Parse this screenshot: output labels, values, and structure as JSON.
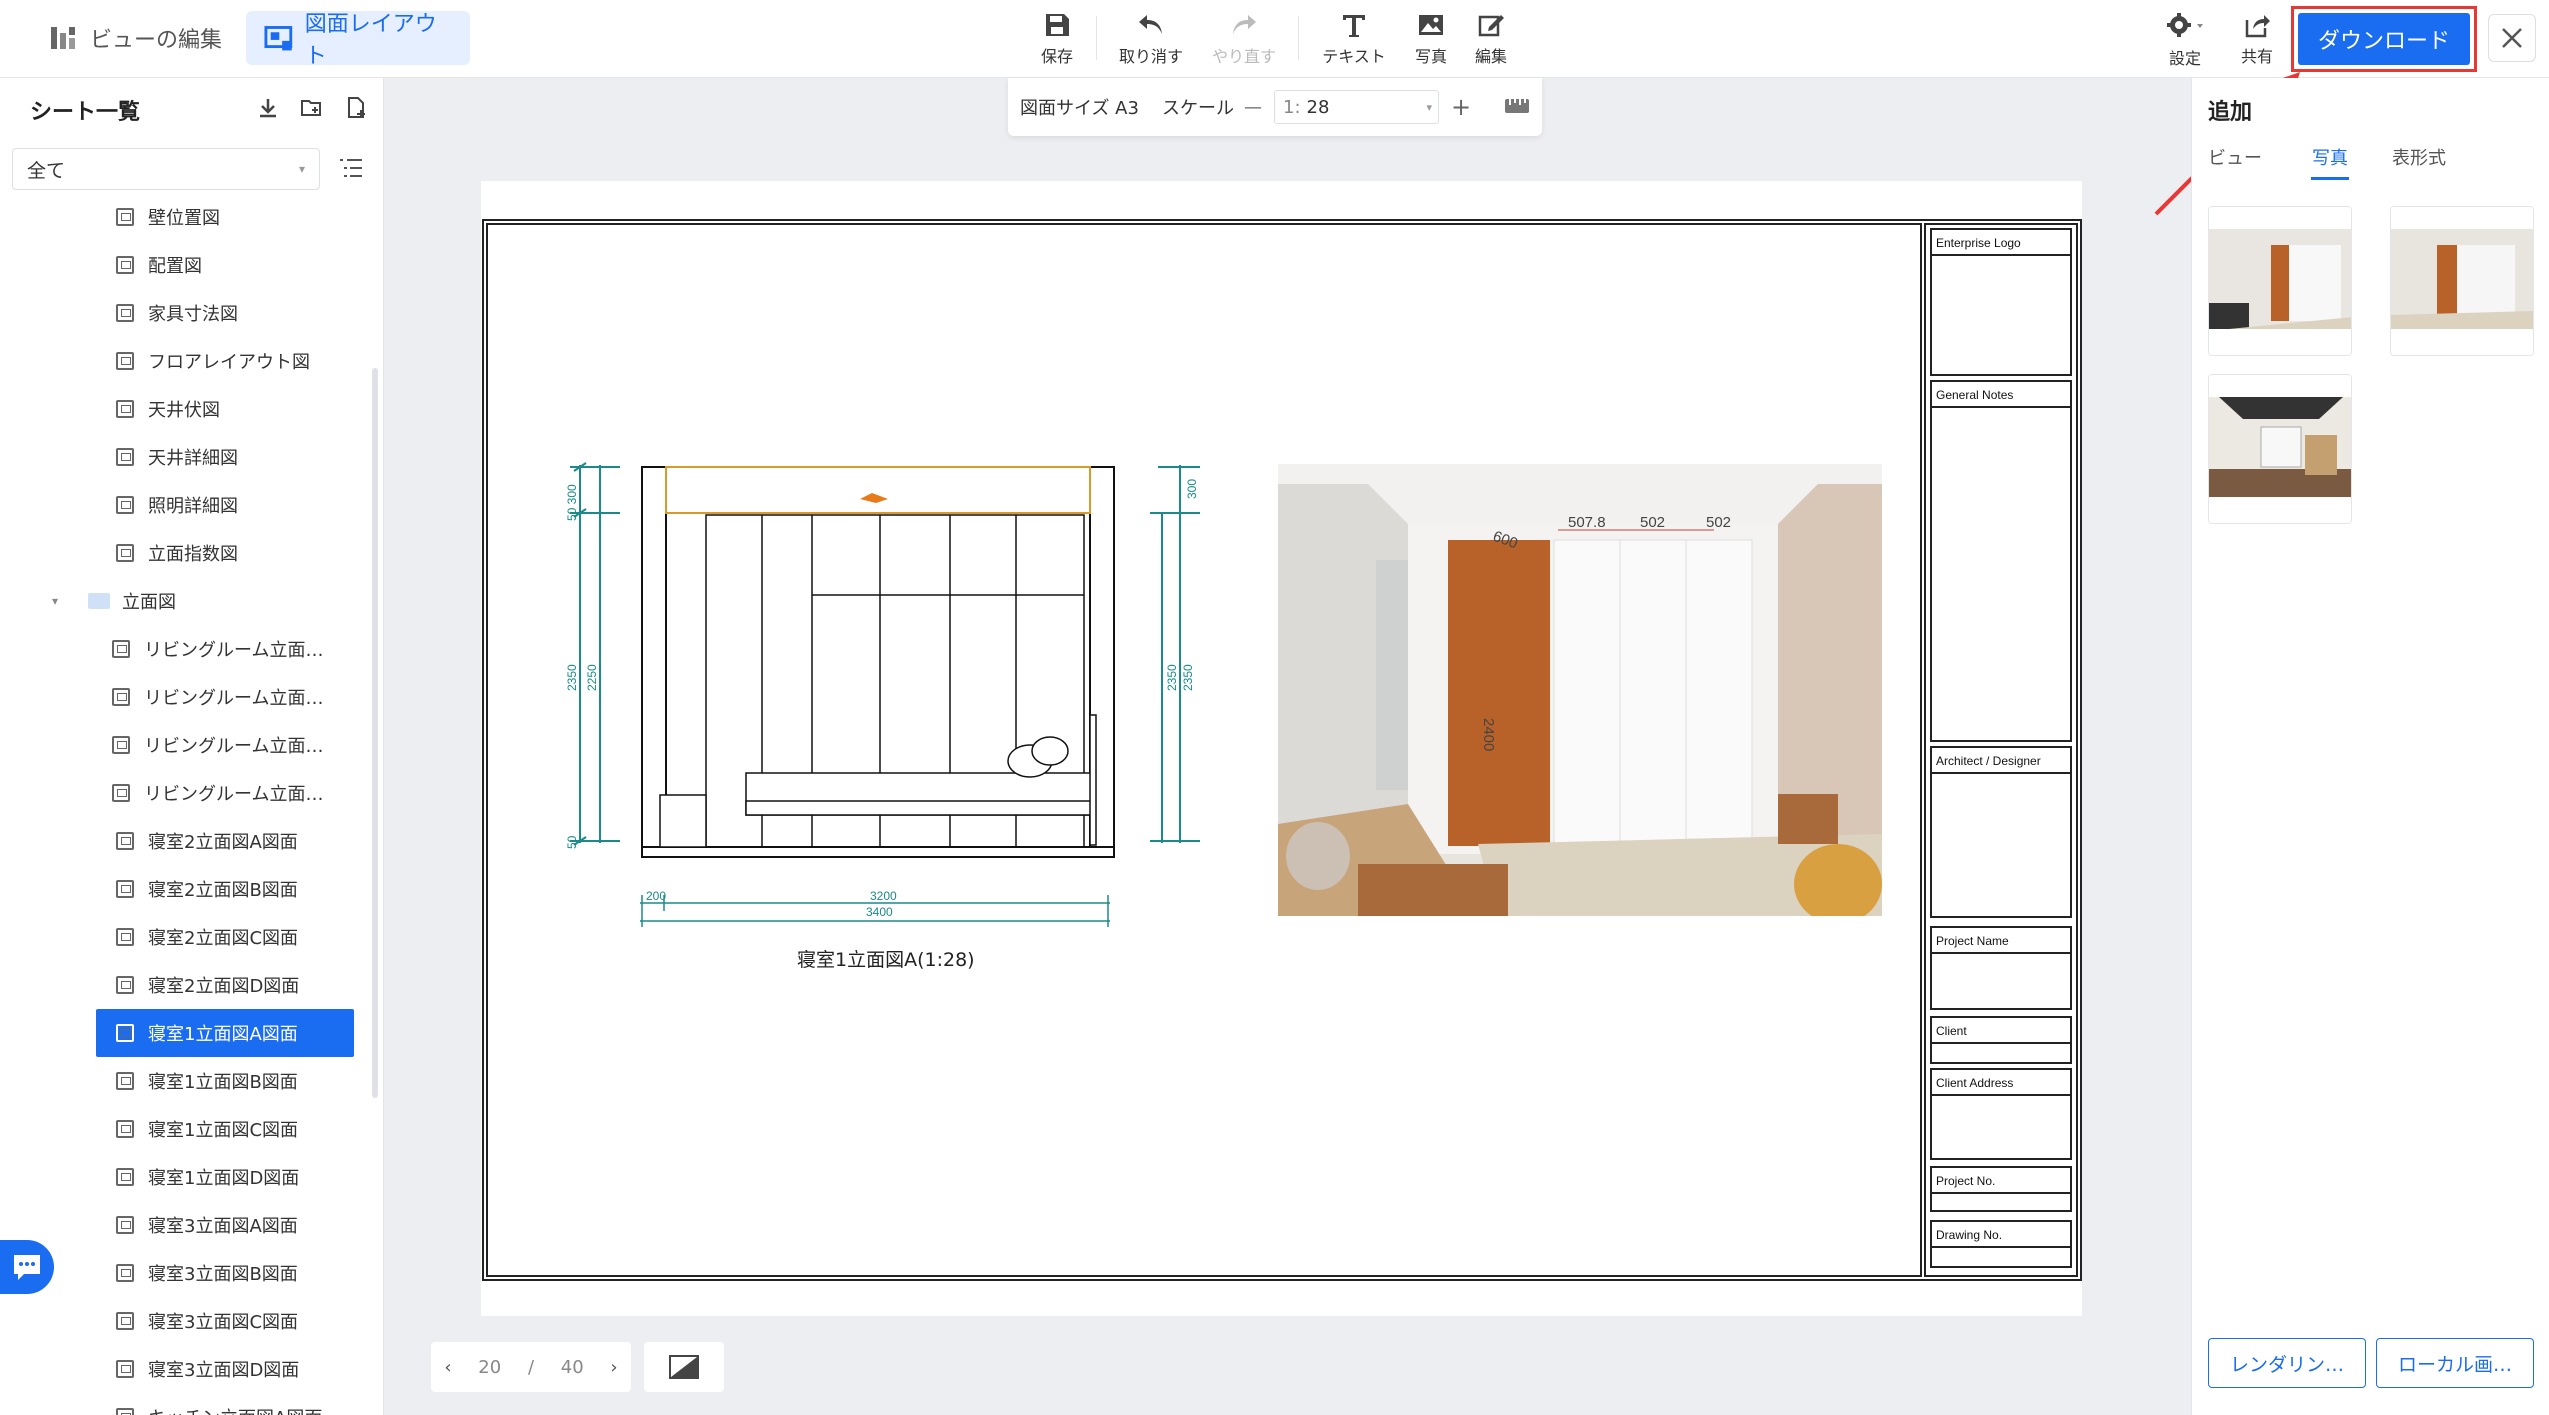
{
  "header": {
    "modes": [
      {
        "label": "ビューの編集",
        "active": false
      },
      {
        "label": "図面レイアウト",
        "active": true
      }
    ],
    "tools": [
      {
        "label": "保存",
        "icon": "save-icon",
        "enabled": true
      },
      {
        "label": "取り消す",
        "icon": "undo-icon",
        "enabled": true
      },
      {
        "label": "やり直す",
        "icon": "redo-icon",
        "enabled": false
      },
      {
        "label": "テキスト",
        "icon": "text-icon",
        "enabled": true
      },
      {
        "label": "写真",
        "icon": "photo-icon",
        "enabled": true
      },
      {
        "label": "編集",
        "icon": "edit-icon",
        "enabled": true
      }
    ],
    "settings_label": "設定",
    "share_label": "共有",
    "download_label": "ダウンロード"
  },
  "sidebar": {
    "title": "シート一覧",
    "filter_value": "全て",
    "items": [
      {
        "label": "壁位置図",
        "indent": 2,
        "type": "file"
      },
      {
        "label": "配置図",
        "indent": 2,
        "type": "file"
      },
      {
        "label": "家具寸法図",
        "indent": 2,
        "type": "file"
      },
      {
        "label": "フロアレイアウト図",
        "indent": 2,
        "type": "file"
      },
      {
        "label": "天井伏図",
        "indent": 2,
        "type": "file"
      },
      {
        "label": "天井詳細図",
        "indent": 2,
        "type": "file"
      },
      {
        "label": "照明詳細図",
        "indent": 2,
        "type": "file"
      },
      {
        "label": "立面指数図",
        "indent": 2,
        "type": "file"
      },
      {
        "label": "立面図",
        "indent": 1,
        "type": "folder"
      },
      {
        "label": "リビングルーム立面…",
        "indent": 2,
        "type": "file"
      },
      {
        "label": "リビングルーム立面…",
        "indent": 2,
        "type": "file"
      },
      {
        "label": "リビングルーム立面…",
        "indent": 2,
        "type": "file"
      },
      {
        "label": "リビングルーム立面…",
        "indent": 2,
        "type": "file"
      },
      {
        "label": "寝室2立面図A図面",
        "indent": 2,
        "type": "file"
      },
      {
        "label": "寝室2立面図B図面",
        "indent": 2,
        "type": "file"
      },
      {
        "label": "寝室2立面図C図面",
        "indent": 2,
        "type": "file"
      },
      {
        "label": "寝室2立面図D図面",
        "indent": 2,
        "type": "file"
      },
      {
        "label": "寝室1立面図A図面",
        "indent": 2,
        "type": "file",
        "selected": true
      },
      {
        "label": "寝室1立面図B図面",
        "indent": 2,
        "type": "file"
      },
      {
        "label": "寝室1立面図C図面",
        "indent": 2,
        "type": "file"
      },
      {
        "label": "寝室1立面図D図面",
        "indent": 2,
        "type": "file"
      },
      {
        "label": "寝室3立面図A図面",
        "indent": 2,
        "type": "file"
      },
      {
        "label": "寝室3立面図B図面",
        "indent": 2,
        "type": "file"
      },
      {
        "label": "寝室3立面図C図面",
        "indent": 2,
        "type": "file"
      },
      {
        "label": "寝室3立面図D図面",
        "indent": 2,
        "type": "file"
      },
      {
        "label": "キッチン立面図A図面",
        "indent": 2,
        "type": "file"
      }
    ]
  },
  "canvas": {
    "paper_size_label": "図面サイズ A3",
    "scale_label": "スケール",
    "scale_prefix": "1:",
    "scale_value": "28",
    "elevation_caption": "寝室1立面図A(1:28)",
    "dims": {
      "left_top": "50 300",
      "left_mid_a": "2350",
      "left_mid_b": "2250",
      "left_bottom": "50",
      "right_top": "300",
      "right_mid_a": "2350",
      "right_mid_b": "2350",
      "bottom_small": "200",
      "bottom_inner": "3200",
      "bottom_total": "3400"
    },
    "render_dims": [
      "600",
      "507.8",
      "502",
      "502",
      "2400"
    ],
    "title_block": [
      "Enterprise Logo",
      "General Notes",
      "Architect / Designer",
      "Project Name",
      "Client",
      "Client Address",
      "Project No.",
      "Drawing No."
    ],
    "pager": {
      "current": "20",
      "separator": "/",
      "total": "40"
    }
  },
  "right_panel": {
    "title": "追加",
    "tabs": [
      {
        "label": "ビュー",
        "active": false
      },
      {
        "label": "写真",
        "active": true
      },
      {
        "label": "表形式",
        "active": false
      }
    ],
    "thumbnails": [
      "render-thumb-1",
      "render-thumb-2",
      "render-thumb-3"
    ],
    "buttons": [
      "レンダリン…",
      "ローカル画…"
    ]
  },
  "colors": {
    "accent": "#1a6cf0",
    "highlight_border": "#e53935",
    "dimension_line": "#1a8a8a",
    "wardrobe_wood": "#b8622a"
  }
}
